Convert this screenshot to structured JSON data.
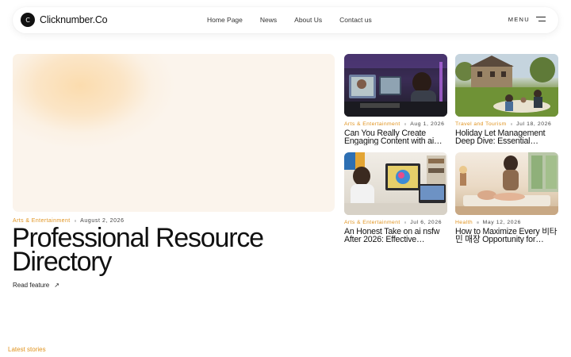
{
  "header": {
    "logo_mark": "C",
    "logo_text": "Clicknumber.Co",
    "nav": [
      "Home Page",
      "News",
      "About Us",
      "Contact us"
    ],
    "menu_label": "MENU"
  },
  "hero": {
    "category": "Arts & Entertainment",
    "date": "August 2, 2026",
    "title": "Professional Resource Directory",
    "read_label": "Read feature",
    "read_icon": "↗"
  },
  "cards": [
    {
      "category": "Arts & Entertainment",
      "date": "Aug 1, 2026",
      "title": "Can You Really Create Engaging Content with ai…"
    },
    {
      "category": "Travel and Tourism",
      "date": "Jul 18, 2026",
      "title": "Holiday Let Management Deep Dive: Essential…"
    },
    {
      "category": "Arts & Entertainment",
      "date": "Jul 6, 2026",
      "title": "An Honest Take on ai nsfw After 2026: Effective…"
    },
    {
      "category": "Health",
      "date": "May 12, 2026",
      "title": "How to Maximize Every 비타민 매장 Opportunity for…"
    }
  ],
  "latest_label": "Latest stories",
  "colors": {
    "accent": "#e0931f",
    "text": "#111111"
  }
}
